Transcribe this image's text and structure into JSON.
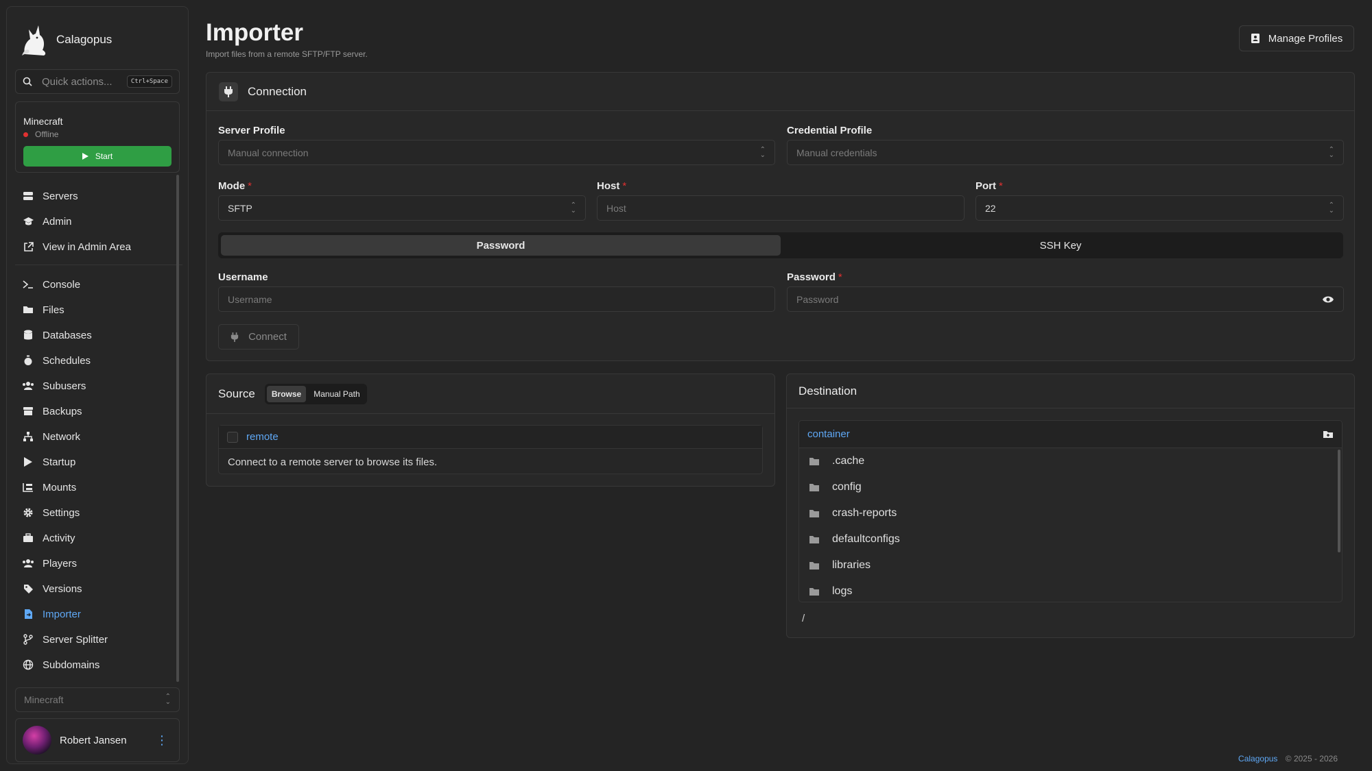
{
  "brand": {
    "name": "Calagopus"
  },
  "search": {
    "placeholder": "Quick actions...",
    "shortcut": "Ctrl+Space"
  },
  "server": {
    "name": "Minecraft",
    "status": "Offline",
    "start_label": "Start",
    "status_color": "#e03131"
  },
  "nav": {
    "top": [
      {
        "label": "Servers",
        "icon": "server-icon"
      },
      {
        "label": "Admin",
        "icon": "admin-icon"
      },
      {
        "label": "View in Admin Area",
        "icon": "external-link-icon"
      }
    ],
    "server": [
      {
        "label": "Console",
        "icon": "terminal-icon"
      },
      {
        "label": "Files",
        "icon": "folder-icon"
      },
      {
        "label": "Databases",
        "icon": "database-icon"
      },
      {
        "label": "Schedules",
        "icon": "stopwatch-icon"
      },
      {
        "label": "Subusers",
        "icon": "users-icon"
      },
      {
        "label": "Backups",
        "icon": "archive-icon"
      },
      {
        "label": "Network",
        "icon": "network-icon"
      },
      {
        "label": "Startup",
        "icon": "play-icon"
      },
      {
        "label": "Mounts",
        "icon": "mounts-icon"
      },
      {
        "label": "Settings",
        "icon": "gear-icon"
      },
      {
        "label": "Activity",
        "icon": "briefcase-icon"
      },
      {
        "label": "Players",
        "icon": "players-icon"
      },
      {
        "label": "Versions",
        "icon": "tag-icon"
      },
      {
        "label": "Importer",
        "icon": "file-import-icon",
        "active": true
      },
      {
        "label": "Server Splitter",
        "icon": "branch-icon"
      },
      {
        "label": "Subdomains",
        "icon": "globe-icon"
      }
    ]
  },
  "server_select": {
    "value": "Minecraft"
  },
  "user": {
    "name": "Robert Jansen"
  },
  "header": {
    "title": "Importer",
    "subtitle": "Import files from a remote SFTP/FTP server.",
    "manage_profiles_label": "Manage Profiles"
  },
  "connection": {
    "title": "Connection",
    "server_profile": {
      "label": "Server Profile",
      "placeholder": "Manual connection"
    },
    "credential_profile": {
      "label": "Credential Profile",
      "placeholder": "Manual credentials"
    },
    "mode": {
      "label": "Mode",
      "value": "SFTP"
    },
    "host": {
      "label": "Host",
      "placeholder": "Host"
    },
    "port": {
      "label": "Port",
      "value": "22"
    },
    "auth_tabs": [
      "Password",
      "SSH Key"
    ],
    "username": {
      "label": "Username",
      "placeholder": "Username"
    },
    "password": {
      "label": "Password",
      "placeholder": "Password"
    },
    "connect_label": "Connect"
  },
  "source": {
    "title": "Source",
    "tabs": [
      "Browse",
      "Manual Path"
    ],
    "root": "remote",
    "message": "Connect to a remote server to browse its files."
  },
  "destination": {
    "title": "Destination",
    "root": "container",
    "folders": [
      ".cache",
      "config",
      "crash-reports",
      "defaultconfigs",
      "libraries",
      "logs"
    ],
    "path": "/"
  },
  "footer": {
    "brand": "Calagopus",
    "copyright": "© 2025 - 2026"
  },
  "colors": {
    "accent": "#5fa8f5",
    "success": "#2f9e44",
    "danger": "#e03131",
    "background": "#242424"
  }
}
